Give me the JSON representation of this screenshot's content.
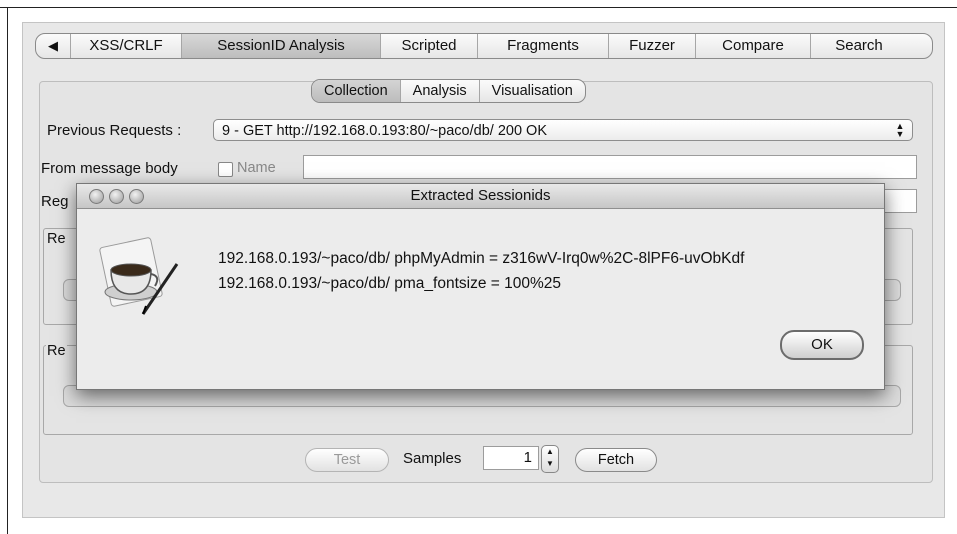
{
  "top_tabs": {
    "arrow": "◀",
    "items": [
      "XSS/CRLF",
      "SessionID Analysis",
      "Scripted",
      "Fragments",
      "Fuzzer",
      "Compare",
      "Search"
    ],
    "active": "SessionID Analysis"
  },
  "sub_tabs": {
    "items": [
      "Collection",
      "Analysis",
      "Visualisation"
    ],
    "active": "Collection"
  },
  "form": {
    "previous_requests_label": "Previous Requests :",
    "previous_requests_value": "9 - GET http://192.168.0.193:80/~paco/db/    200 OK",
    "from_message_body_label": "From message body",
    "name_label": "Name",
    "regex_label_partial": "Reg",
    "group1_label_partial": "Re",
    "group2_label_partial": "Re"
  },
  "bottom": {
    "test_label": "Test",
    "samples_label": "Samples",
    "samples_value": "1",
    "fetch_label": "Fetch"
  },
  "dialog": {
    "title": "Extracted Sessionids",
    "lines": [
      "192.168.0.193/~paco/db/ phpMyAdmin = z316wV-Irq0w%2C-8lPF6-uvObKdf",
      "192.168.0.193/~paco/db/ pma_fontsize = 100%25"
    ],
    "ok_label": "OK",
    "icon": "coffee-cup-pen-icon"
  }
}
